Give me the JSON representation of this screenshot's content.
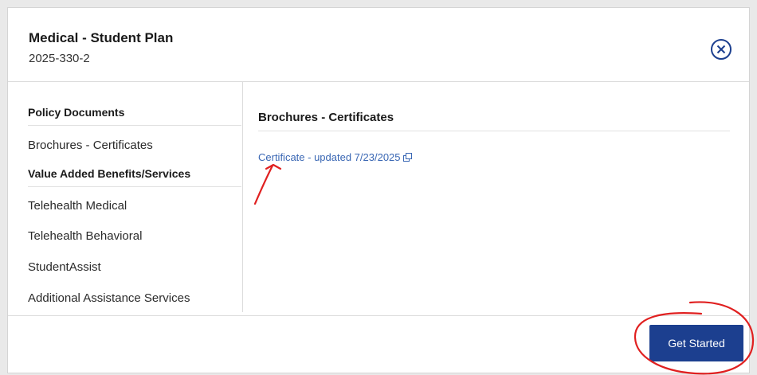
{
  "modal": {
    "title": "Medical - Student Plan",
    "subtitle": "2025-330-2",
    "close_icon": "circle-x-icon"
  },
  "sidebar": {
    "sections": [
      {
        "heading": "Policy Documents",
        "items": [
          "Brochures - Certificates"
        ]
      },
      {
        "heading": "Value Added Benefits/Services",
        "items": [
          "Telehealth Medical",
          "Telehealth Behavioral",
          "StudentAssist",
          "Additional Assistance Services"
        ]
      }
    ]
  },
  "main": {
    "heading": "Brochures - Certificates",
    "links": [
      {
        "label": "Certificate - updated 7/23/2025",
        "icon": "external-link-icon"
      }
    ]
  },
  "footer": {
    "button_label": "Get Started"
  },
  "colors": {
    "link": "#3a67b4",
    "primary_button": "#1c3f8f",
    "annotation": "#e02020"
  }
}
